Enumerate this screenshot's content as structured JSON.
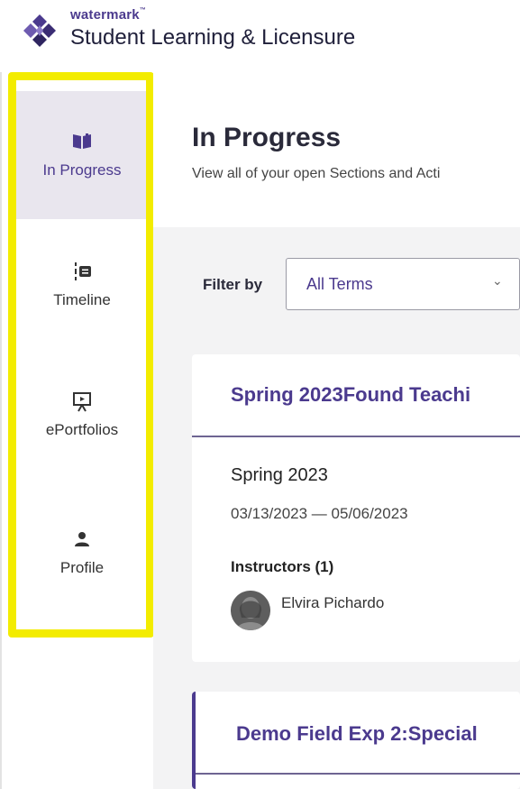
{
  "brand": {
    "top": "watermark",
    "tm": "™",
    "main": "Student Learning & Licensure",
    "color": "#4b3a8e"
  },
  "sidebar": {
    "items": [
      {
        "label": "In Progress",
        "icon": "book-icon",
        "active": true
      },
      {
        "label": "Timeline",
        "icon": "timeline-icon",
        "active": false
      },
      {
        "label": "ePortfolios",
        "icon": "presentation-icon",
        "active": false
      },
      {
        "label": "Profile",
        "icon": "person-icon",
        "active": false
      }
    ],
    "highlight_color": "#f3ec00"
  },
  "page": {
    "title": "In Progress",
    "subtitle": "View all of your open Sections and Acti"
  },
  "filter": {
    "label": "Filter by",
    "value": "All Terms",
    "chevron": "⌄"
  },
  "cards": [
    {
      "title": "Spring 2023Found Teachi",
      "term": "Spring 2023",
      "dates": "03/13/2023 — 05/06/2023",
      "instructors_label": "Instructors (1)",
      "instructor": "Elvira Pichardo"
    },
    {
      "title": "Demo Field Exp 2:Special"
    }
  ]
}
